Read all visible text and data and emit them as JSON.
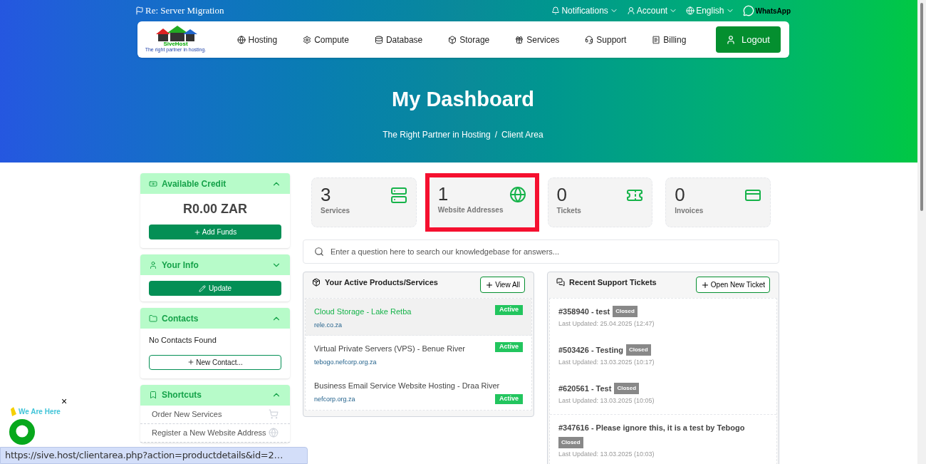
{
  "top_bar": {
    "subject": "Re: Server Migration",
    "links": [
      {
        "kind": "bell",
        "label": "Notifications"
      },
      {
        "kind": "user",
        "label": "Account"
      },
      {
        "kind": "globe",
        "label": "English"
      }
    ],
    "whatsapp": "WhatsApp"
  },
  "nav": {
    "logo": {
      "name": "SiveHost",
      "tagline": "The right partner in hosting."
    },
    "items": [
      {
        "kind": "globe",
        "label": "Hosting"
      },
      {
        "kind": "gear",
        "label": "Compute"
      },
      {
        "kind": "database",
        "label": "Database"
      },
      {
        "kind": "box",
        "label": "Storage"
      },
      {
        "kind": "gift",
        "label": "Services"
      },
      {
        "kind": "headset",
        "label": "Support"
      },
      {
        "kind": "receipt",
        "label": "Billing"
      }
    ],
    "logout": "Logout"
  },
  "hero": {
    "title": "My Dashboard",
    "breadcrumb": [
      "The Right Partner in Hosting",
      "Client Area"
    ],
    "separator": "/"
  },
  "sidebar": {
    "panels": [
      {
        "kind": "credit",
        "title": "Available Credit",
        "expanded": true,
        "amount": "R0.00 ZAR",
        "button": "Add Funds"
      },
      {
        "kind": "info",
        "title": "Your Info",
        "expanded": false,
        "button": "Update"
      },
      {
        "kind": "contacts",
        "title": "Contacts",
        "expanded": true,
        "text": "No Contacts Found",
        "button": "New Contact..."
      },
      {
        "kind": "shortcuts",
        "title": "Shortcuts",
        "expanded": true,
        "items": [
          {
            "kind": "cart",
            "label": "Order New Services"
          },
          {
            "kind": "globe",
            "label": "Register a New Website Address"
          }
        ]
      }
    ]
  },
  "stats": [
    {
      "kind": "server",
      "count": "3",
      "label": "Services",
      "highlighted": false
    },
    {
      "kind": "globe",
      "count": "1",
      "label": "Website Addresses",
      "highlighted": true
    },
    {
      "kind": "ticket",
      "count": "0",
      "label": "Tickets",
      "highlighted": false
    },
    {
      "kind": "card",
      "count": "0",
      "label": "Invoices",
      "highlighted": false
    }
  ],
  "search": {
    "placeholder": "Enter a question here to search our knowledgebase for answers..."
  },
  "products": {
    "title": "Your Active Products/Services",
    "button": "View All",
    "items": [
      {
        "name": "Cloud Storage - Lake Retba",
        "domain": "rele.co.za",
        "status": "Active",
        "selected": true
      },
      {
        "name": "Virtual Private Servers (VPS) - Benue River",
        "domain": "tebogo.nefcorp.org.za",
        "status": "Active",
        "selected": false
      },
      {
        "name": "Business Email Service Website Hosting - Draa River",
        "domain": "nefcorp.org.za",
        "status": "Active",
        "selected": false
      }
    ]
  },
  "tickets": {
    "title": "Recent Support Tickets",
    "button": "Open New Ticket",
    "items": [
      {
        "title": "#358940 - test",
        "status": "Closed",
        "updated": "Last Updated: 25.04.2025 (12:47)"
      },
      {
        "title": "#503426 - Testing",
        "status": "Closed",
        "updated": "Last Updated: 13.03.2025 (10:17)"
      },
      {
        "title": "#620561 - Test",
        "status": "Closed",
        "updated": "Last Updated: 13.03.2025 (10:05)"
      },
      {
        "title": "#347616 - Please ignore this, it is a test by Tebogo",
        "status": "Closed",
        "updated": "Last Updated: 13.03.2025 (10:03)"
      }
    ]
  },
  "chat_widget": {
    "label": "We Are Here",
    "close": "×"
  },
  "status_bar": {
    "url": "https://sive.host/clientarea.php?action=productdetails&id=2…"
  }
}
